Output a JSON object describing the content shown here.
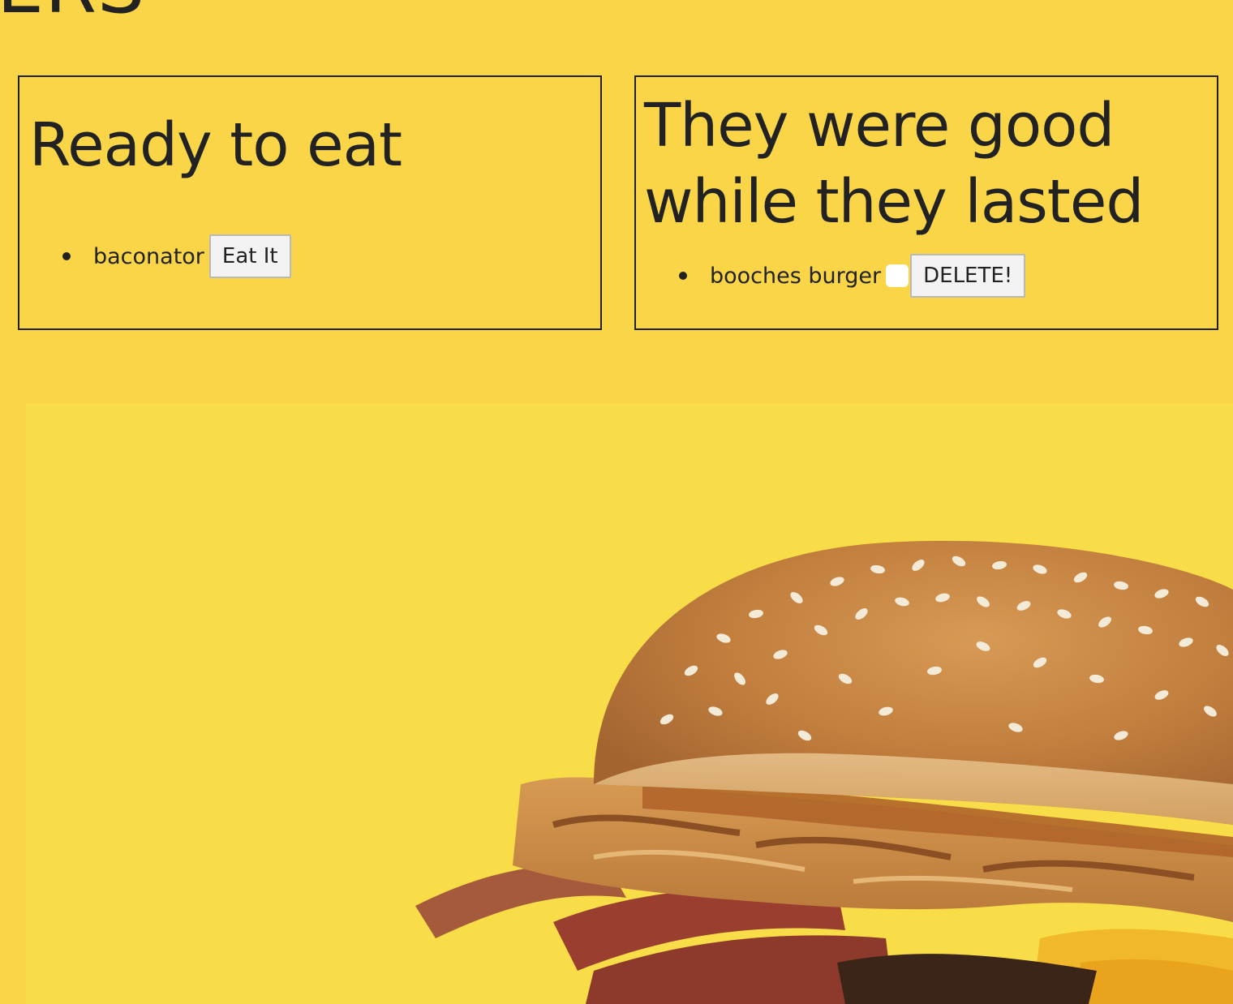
{
  "header": {
    "title_fragment": "ERS"
  },
  "ready_panel": {
    "title": "Ready to eat",
    "items": [
      {
        "name": "baconator",
        "button_label": "Eat It"
      }
    ]
  },
  "eaten_panel": {
    "title": "They were good while they lasted",
    "items": [
      {
        "name": "booches burger",
        "checked": false,
        "button_label": "DELETE!"
      }
    ]
  },
  "hero": {
    "image": "burger-photo"
  },
  "colors": {
    "background": "#fad547",
    "text": "#222222",
    "border": "#222222",
    "button_bg": "#f3f3f3"
  }
}
